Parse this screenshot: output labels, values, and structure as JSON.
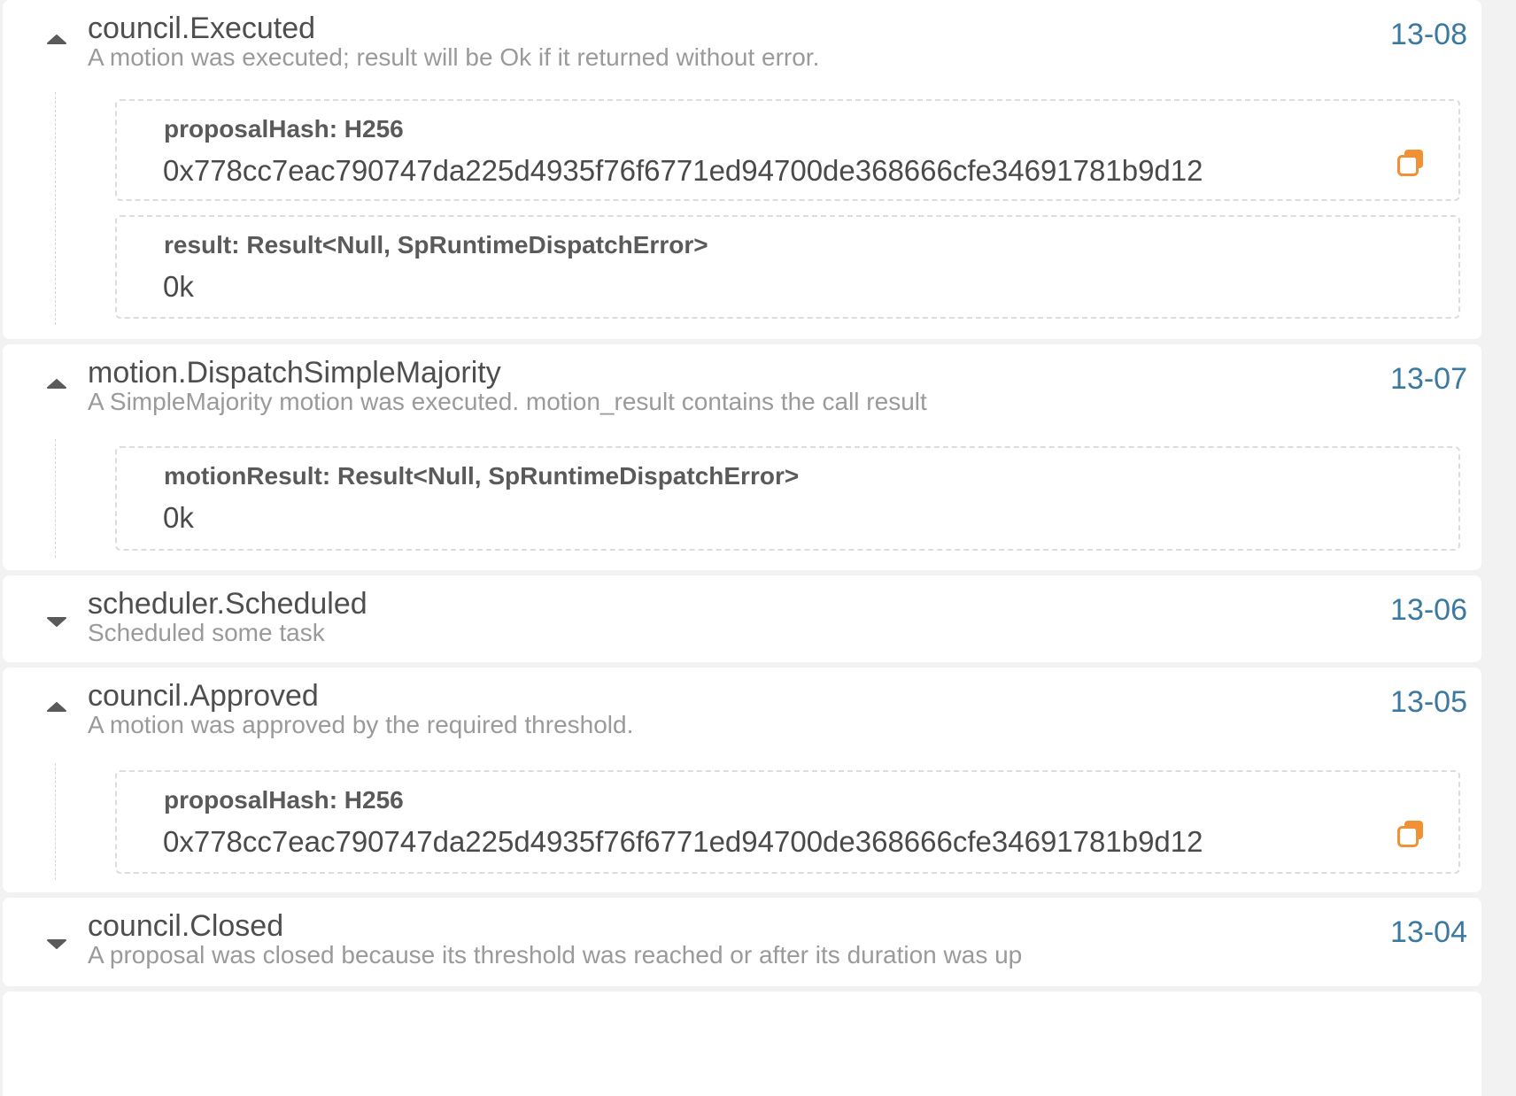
{
  "accent_color": "#f19135",
  "id_color": "#3b79a0",
  "events": [
    {
      "name": "council.Executed",
      "description": "A motion was executed; result will be Ok if it returned without error.",
      "id": "13-08",
      "expanded": true,
      "toggle_icon": "caret-up-icon",
      "params": [
        {
          "label": "proposalHash: H256",
          "value": "0x778cc7eac790747da225d4935f76f6771ed94700de368666cfe34691781b9d12",
          "copy_icon": "copy-icon"
        },
        {
          "label": "result: Result<Null, SpRuntimeDispatchError>",
          "value": "0k"
        }
      ]
    },
    {
      "name": "motion.DispatchSimpleMajority",
      "description": "A SimpleMajority motion was executed. motion_result contains the call result",
      "id": "13-07",
      "expanded": true,
      "toggle_icon": "caret-up-icon",
      "params": [
        {
          "label": "motionResult: Result<Null, SpRuntimeDispatchError>",
          "value": "0k"
        }
      ]
    },
    {
      "name": "scheduler.Scheduled",
      "description": "Scheduled some task",
      "id": "13-06",
      "expanded": false,
      "toggle_icon": "caret-down-icon",
      "params": []
    },
    {
      "name": "council.Approved",
      "description": "A motion was approved by the required threshold.",
      "id": "13-05",
      "expanded": true,
      "toggle_icon": "caret-up-icon",
      "params": [
        {
          "label": "proposalHash: H256",
          "value": "0x778cc7eac790747da225d4935f76f6771ed94700de368666cfe34691781b9d12",
          "copy_icon": "copy-icon"
        }
      ]
    },
    {
      "name": "council.Closed",
      "description": "A proposal was closed because its threshold was reached or after its duration was up",
      "id": "13-04",
      "expanded": false,
      "toggle_icon": "caret-down-icon",
      "params": []
    }
  ]
}
